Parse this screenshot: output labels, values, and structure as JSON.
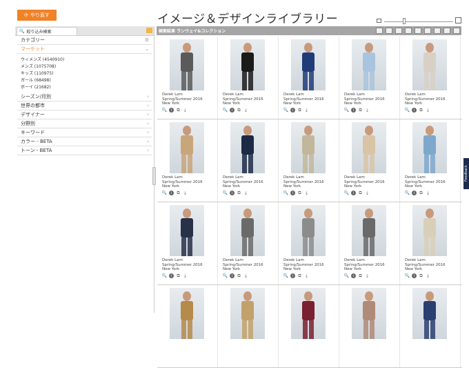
{
  "header": {
    "undo_label": "やり直す",
    "title": "イメージ＆デザインライブラリー"
  },
  "sidebar": {
    "tab_label": "絞り込み検索",
    "facets_top": [
      {
        "label": "カテゴリー",
        "icon": "gear-icon",
        "color": "#333333"
      },
      {
        "label": "マーケット",
        "icon": "chevron-down-icon",
        "color": "#f08228"
      }
    ],
    "market_items": [
      "ウィメンズ (4540910)",
      "メンズ (1075708)",
      "キッズ (110975)",
      "ガール (68498)",
      "ボーイ (21682)"
    ],
    "facets_bottom": [
      "シーズン/月別",
      "世界の都市",
      "デザイナー",
      "分野別",
      "キーワード",
      "カラー - BETA",
      "トーン - BETA"
    ]
  },
  "toolbar": {
    "label": "検索結果 ランウェイ&コレクション",
    "tools": [
      "list-view-icon",
      "grid-view-icon",
      "detail-view-icon",
      "folder-icon",
      "print-icon",
      "mail-icon",
      "download-icon",
      "save-icon",
      "share-icon"
    ]
  },
  "results": {
    "caption_designer": "Derek Lam",
    "caption_season": "Spring/Summer 2016",
    "caption_city": "New York",
    "rows": 4,
    "cols": 5,
    "image_colors": [
      [
        "#5a5a5a",
        "#1a1a1a",
        "#1f3c78",
        "#a9c4de",
        "#d8d0c4"
      ],
      [
        "#c9a57a",
        "#1c2a44",
        "#c2b79a",
        "#d9c4a8",
        "#7ea7cc"
      ],
      [
        "#28304a",
        "#6a6a6a",
        "#8c8c8c",
        "#6a6a6a",
        "#d9cfb8"
      ],
      [
        "#b58a4a",
        "#c2a26a",
        "#7a2030",
        "#b08a78",
        "#2a4070"
      ]
    ]
  },
  "feedback_label": "Feedback"
}
